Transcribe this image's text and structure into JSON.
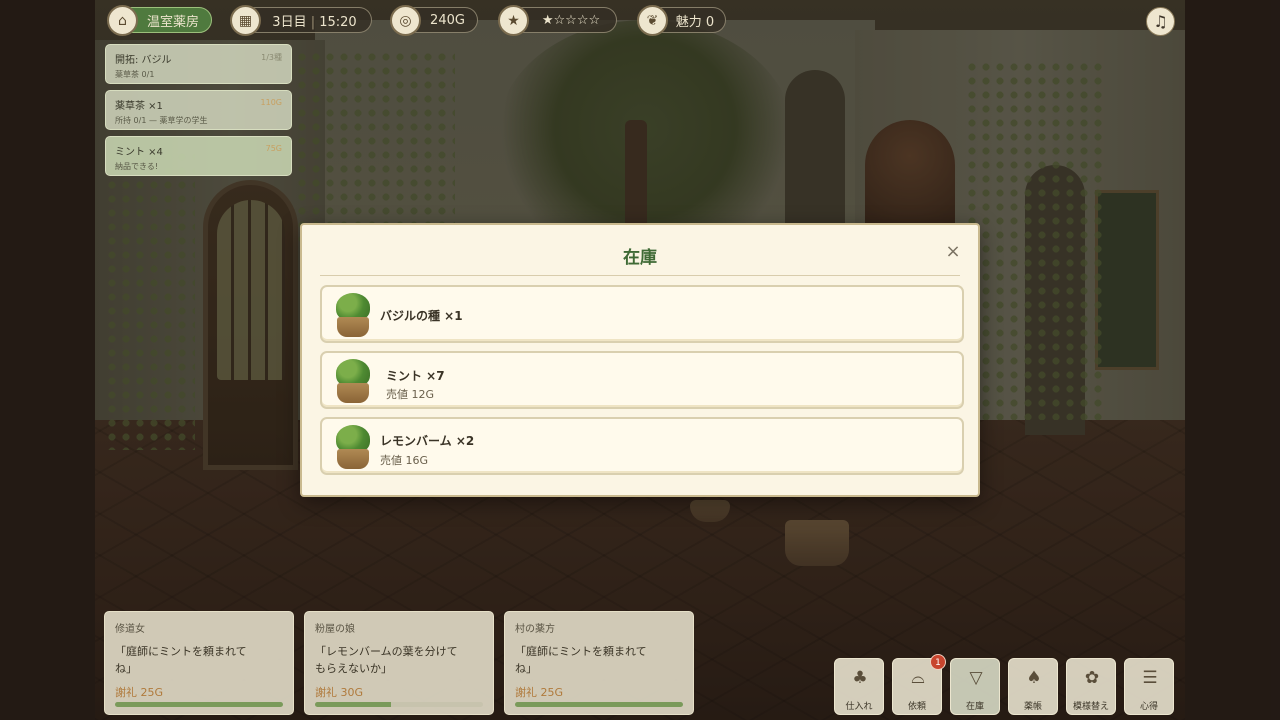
{
  "hud": {
    "shop_name": "温室薬房",
    "day": "3日目",
    "time": "15:20",
    "gold": "240G",
    "rating": "★☆☆☆☆",
    "charm": "魅力 0"
  },
  "quests": [
    {
      "title": "開拓: バジル",
      "sub": "薬草茶 0/1",
      "right": "1/3種"
    },
    {
      "title": "薬草茶 ×1",
      "sub": "所持 0/1 — 薬草学の学生",
      "right": "110G"
    },
    {
      "title": "ミント ×4",
      "sub": "納品できる!",
      "right": "75G"
    }
  ],
  "inventory": {
    "title": "在庫",
    "close_label": "×",
    "items": [
      {
        "name": "バジルの種 ×1",
        "price": ""
      },
      {
        "name": "ミント ×7",
        "price": "売値 12G"
      },
      {
        "name": "レモンバーム ×2",
        "price": "売値 16G"
      }
    ]
  },
  "requests": [
    {
      "who": "修道女",
      "line1": "「庭師にミントを頼まれて",
      "line2": "ね」",
      "reward": "謝礼 25G",
      "progress": 1.0
    },
    {
      "who": "粉屋の娘",
      "line1": "「レモンバームの葉を分けて",
      "line2": "もらえないか」",
      "reward": "謝礼 30G",
      "progress": 0.45
    },
    {
      "who": "村の薬方",
      "line1": "「庭師にミントを頼まれて",
      "line2": "ね」",
      "reward": "謝礼 25G",
      "progress": 1.0
    }
  ],
  "actions": [
    {
      "label": "仕入れ",
      "icon": "basket-icon"
    },
    {
      "label": "依頼",
      "icon": "request-basket-icon",
      "badge": "1"
    },
    {
      "label": "在庫",
      "icon": "inventory-icon"
    },
    {
      "label": "薬帳",
      "icon": "recipe-book-icon"
    },
    {
      "label": "模様替え",
      "icon": "potted-plant-icon"
    },
    {
      "label": "心得",
      "icon": "guide-icon"
    }
  ],
  "icons": {
    "music": "music-note-icon",
    "calendar": "calendar-icon",
    "coin": "coin-icon",
    "star": "star-icon",
    "leaf": "leaf-icon",
    "shop": "shop-basket-icon"
  },
  "colors": {
    "accent_green": "#4f7a3e",
    "modal_title": "#3f6a35",
    "reward": "#b07a3c",
    "badge": "#c8452e"
  }
}
